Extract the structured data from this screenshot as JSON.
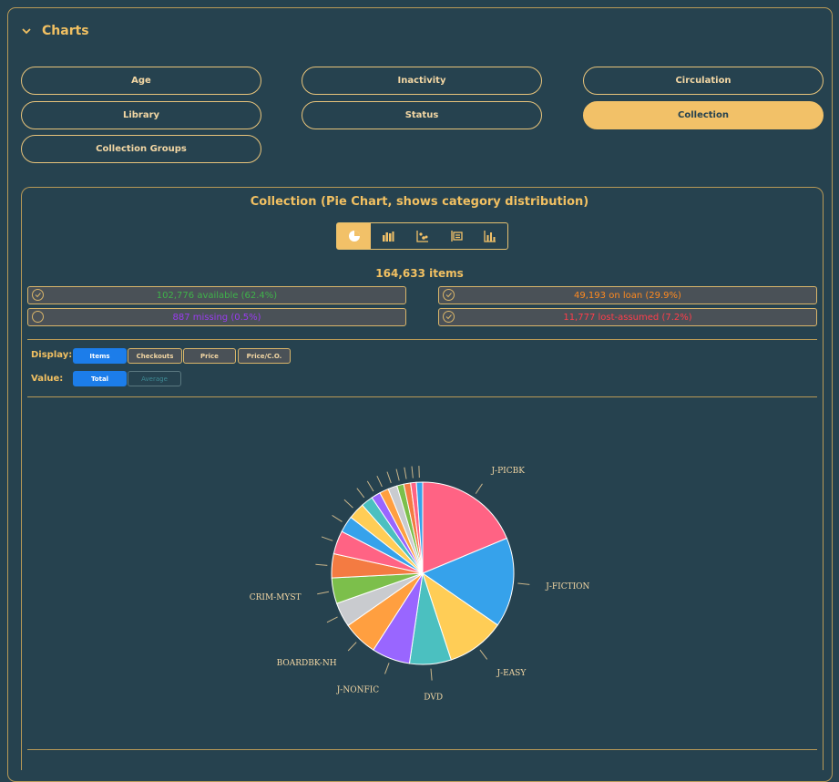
{
  "section": {
    "title": "Charts"
  },
  "chart_buttons": [
    "Age",
    "Inactivity",
    "Circulation",
    "Library",
    "Status",
    "Collection",
    "Collection Groups"
  ],
  "active_chart_button": "Collection",
  "chart_panel": {
    "title": "Collection (Pie Chart, shows category distribution)",
    "toolbar_icons": [
      "pie-chart-icon",
      "bar-chart-icon",
      "scatter-chart-icon",
      "table-icon",
      "histogram-icon"
    ],
    "total_label": "164,633 items"
  },
  "stats": [
    {
      "text": "102,776 available (62.4%)",
      "color": "#3fb24a",
      "icon": "check-circle-icon"
    },
    {
      "text": "49,193 on loan (29.9%)",
      "color": "#ff8a1f",
      "icon": "check-circle-icon"
    },
    {
      "text": "887 missing (0.5%)",
      "color": "#9a3cf0",
      "icon": "circle-icon"
    },
    {
      "text": "11,777 lost-assumed (7.2%)",
      "color": "#ff3d4a",
      "icon": "check-circle-icon"
    }
  ],
  "display": {
    "label": "Display:",
    "options": [
      "Items",
      "Checkouts",
      "Price",
      "Price/C.O."
    ],
    "selected": "Items"
  },
  "value": {
    "label": "Value:",
    "options": [
      "Total",
      "Average"
    ],
    "selected": "Total",
    "disabled": [
      "Average"
    ]
  },
  "chart_data": {
    "type": "pie",
    "slices": [
      {
        "label": "J-PICBK",
        "value": 18.5,
        "color": "#ff6384"
      },
      {
        "label": "J-FICTION",
        "value": 15.7,
        "color": "#36a2eb"
      },
      {
        "label": "J-EASY",
        "value": 10.2,
        "color": "#ffcd56"
      },
      {
        "label": "DVD",
        "value": 7.3,
        "color": "#4bc0c0"
      },
      {
        "label": "J-NONFIC",
        "value": 6.7,
        "color": "#9966ff"
      },
      {
        "label": "BOARDBK-NH",
        "value": 6.1,
        "color": "#ff9f40"
      },
      {
        "label": "",
        "value": 4.3,
        "color": "#c9cbcf"
      },
      {
        "label": "CRIM-MYST",
        "value": 4.5,
        "color": "#7cbf4b"
      },
      {
        "label": "",
        "value": 4.2,
        "color": "#f47b42"
      },
      {
        "label": "",
        "value": 4.1,
        "color": "#ff6384"
      },
      {
        "label": "",
        "value": 2.9,
        "color": "#36a2eb"
      },
      {
        "label": "",
        "value": 2.9,
        "color": "#ffcd56"
      },
      {
        "label": "",
        "value": 2.1,
        "color": "#4bc0c0"
      },
      {
        "label": "",
        "value": 1.6,
        "color": "#9966ff"
      },
      {
        "label": "",
        "value": 1.6,
        "color": "#ff9f40"
      },
      {
        "label": "",
        "value": 1.6,
        "color": "#c9cbcf"
      },
      {
        "label": "",
        "value": 1.2,
        "color": "#7cbf4b"
      },
      {
        "label": "",
        "value": 1.2,
        "color": "#f47b42"
      },
      {
        "label": "",
        "value": 1.0,
        "color": "#ff6384"
      },
      {
        "label": "",
        "value": 1.1,
        "color": "#36a2eb"
      }
    ]
  }
}
